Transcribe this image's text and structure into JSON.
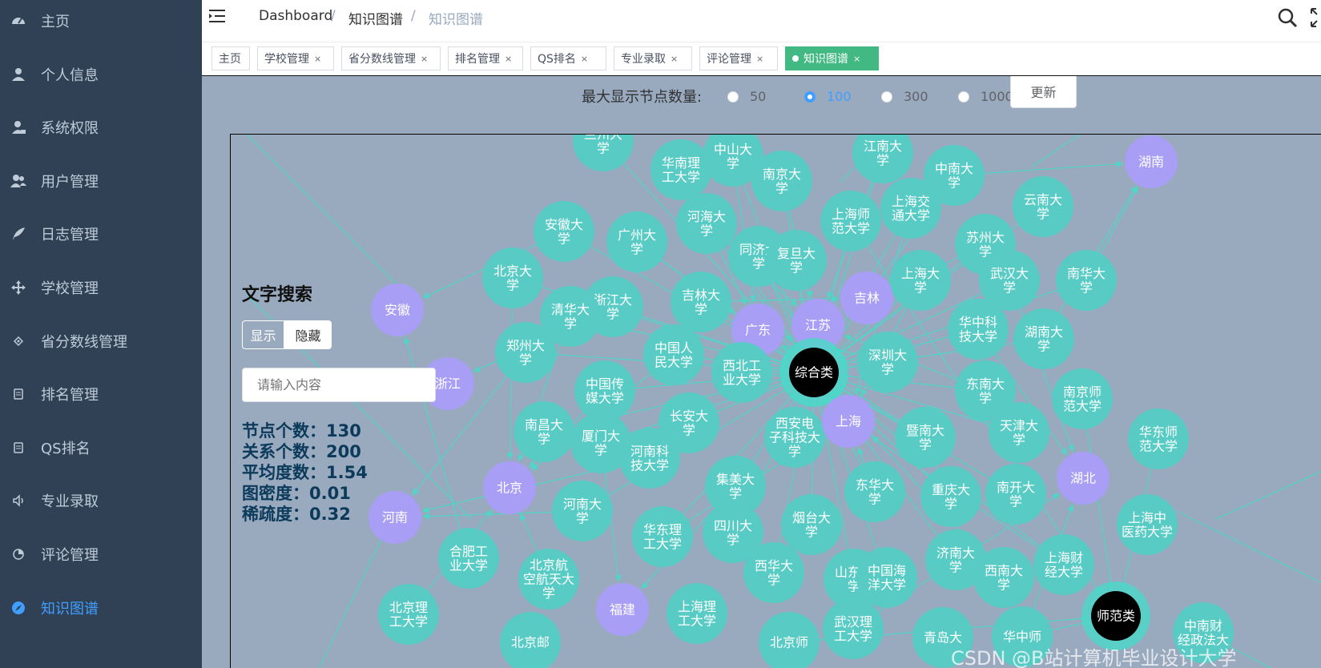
{
  "sidebar": {
    "items": [
      {
        "label": "主页",
        "icon": "dashboard-icon"
      },
      {
        "label": "个人信息",
        "icon": "user-icon"
      },
      {
        "label": "系统权限",
        "icon": "user-lock-icon"
      },
      {
        "label": "用户管理",
        "icon": "users-icon"
      },
      {
        "label": "日志管理",
        "icon": "feather-icon"
      },
      {
        "label": "学校管理",
        "icon": "move-icon"
      },
      {
        "label": "省分数线管理",
        "icon": "component-icon"
      },
      {
        "label": "排名管理",
        "icon": "table-icon"
      },
      {
        "label": "QS排名",
        "icon": "table-icon"
      },
      {
        "label": "专业录取",
        "icon": "speaker-icon"
      },
      {
        "label": "评论管理",
        "icon": "chart-icon"
      },
      {
        "label": "知识图谱",
        "icon": "compass-icon",
        "active": true
      }
    ]
  },
  "header": {
    "breadcrumb": [
      "Dashboard",
      "知识图谱",
      "知识图谱"
    ],
    "separator": "/"
  },
  "tabs": [
    {
      "label": "主页"
    },
    {
      "label": "学校管理",
      "closable": true
    },
    {
      "label": "省分数线管理",
      "closable": true
    },
    {
      "label": "排名管理",
      "closable": true
    },
    {
      "label": "QS排名",
      "closable": true
    },
    {
      "label": "专业录取",
      "closable": true
    },
    {
      "label": "评论管理",
      "closable": true
    },
    {
      "label": "知识图谱",
      "closable": true,
      "active": true
    }
  ],
  "controls": {
    "max_nodes_label": "最大显示节点数量:",
    "options": [
      "50",
      "100",
      "300",
      "1000"
    ],
    "selected": "100",
    "update_button": "更新"
  },
  "search": {
    "title": "文字搜索",
    "show_label": "显示",
    "hide_label": "隐藏",
    "placeholder": "请输入内容",
    "stats": {
      "nodes": "节点个数：130",
      "relations": "关系个数：200",
      "avg_degree": "平均度数：1.54",
      "density": "图密度：0.01",
      "sparsity": "稀疏度：0.32"
    }
  },
  "graph": {
    "colors": {
      "university": "#57cbc4",
      "province": "#a99ef6",
      "category": "#000000",
      "edge": "#4fd6c9"
    },
    "nodes": [
      {
        "id": "兰州大学",
        "type": "university"
      },
      {
        "id": "中山大学",
        "type": "university"
      },
      {
        "id": "华南理工大学",
        "type": "university"
      },
      {
        "id": "南京大学",
        "type": "university"
      },
      {
        "id": "江南大学",
        "type": "university"
      },
      {
        "id": "中南大学",
        "type": "university"
      },
      {
        "id": "湖南",
        "type": "province"
      },
      {
        "id": "云南大学",
        "type": "university"
      },
      {
        "id": "安徽大学",
        "type": "university"
      },
      {
        "id": "广州大学",
        "type": "university"
      },
      {
        "id": "河海大学",
        "type": "university"
      },
      {
        "id": "上海师范大学",
        "type": "university"
      },
      {
        "id": "上海交通大学",
        "type": "university"
      },
      {
        "id": "苏州大学",
        "type": "university"
      },
      {
        "id": "北京大学",
        "type": "university"
      },
      {
        "id": "同济大学",
        "type": "university"
      },
      {
        "id": "复旦大学",
        "type": "university"
      },
      {
        "id": "武汉大学",
        "type": "university"
      },
      {
        "id": "南华大学",
        "type": "university"
      },
      {
        "id": "安徽",
        "type": "province"
      },
      {
        "id": "浙江大学",
        "type": "university"
      },
      {
        "id": "吉林大学",
        "type": "university"
      },
      {
        "id": "吉林",
        "type": "province"
      },
      {
        "id": "上海大学",
        "type": "university"
      },
      {
        "id": "清华大学",
        "type": "university"
      },
      {
        "id": "广东",
        "type": "province"
      },
      {
        "id": "江苏",
        "type": "province"
      },
      {
        "id": "华中科技大学",
        "type": "university"
      },
      {
        "id": "湖南大学",
        "type": "university"
      },
      {
        "id": "郑州大学",
        "type": "university"
      },
      {
        "id": "中国人民大学",
        "type": "university"
      },
      {
        "id": "西北工业大学",
        "type": "university"
      },
      {
        "id": "综合类",
        "type": "category"
      },
      {
        "id": "深圳大学",
        "type": "university"
      },
      {
        "id": "浙江",
        "type": "province"
      },
      {
        "id": "中国传媒大学",
        "type": "university"
      },
      {
        "id": "东南大学",
        "type": "university"
      },
      {
        "id": "南京师范大学",
        "type": "university"
      },
      {
        "id": "南昌大学",
        "type": "university"
      },
      {
        "id": "厦门大学",
        "type": "university"
      },
      {
        "id": "长安大学",
        "type": "university"
      },
      {
        "id": "西安电子科技大学",
        "type": "university"
      },
      {
        "id": "上海",
        "type": "province"
      },
      {
        "id": "暨南大学",
        "type": "university"
      },
      {
        "id": "天津大学",
        "type": "university"
      },
      {
        "id": "华东师范大学",
        "type": "university"
      },
      {
        "id": "河南科技大学",
        "type": "university"
      },
      {
        "id": "北京",
        "type": "province"
      },
      {
        "id": "集美大学",
        "type": "university"
      },
      {
        "id": "东华大学",
        "type": "university"
      },
      {
        "id": "重庆大学",
        "type": "university"
      },
      {
        "id": "南开大学",
        "type": "university"
      },
      {
        "id": "湖北",
        "type": "province"
      },
      {
        "id": "河南",
        "type": "province"
      },
      {
        "id": "河南大学",
        "type": "university"
      },
      {
        "id": "合肥工业大学",
        "type": "university"
      },
      {
        "id": "华东理工大学",
        "type": "university"
      },
      {
        "id": "四川大学",
        "type": "university"
      },
      {
        "id": "烟台大学",
        "type": "university"
      },
      {
        "id": "上海中医药大学",
        "type": "university"
      },
      {
        "id": "北京航空航天大学",
        "type": "university"
      },
      {
        "id": "西华大学",
        "type": "university"
      },
      {
        "id": "山东大学",
        "type": "university"
      },
      {
        "id": "中国海洋大学",
        "type": "university"
      },
      {
        "id": "济南大学",
        "type": "university"
      },
      {
        "id": "西南大学",
        "type": "university"
      },
      {
        "id": "上海财经大学",
        "type": "university"
      },
      {
        "id": "北京理工大学",
        "type": "university"
      },
      {
        "id": "福建",
        "type": "province"
      },
      {
        "id": "上海理工大学",
        "type": "university"
      },
      {
        "id": "武汉理工大学",
        "type": "university"
      },
      {
        "id": "师范类",
        "type": "category"
      },
      {
        "id": "北京邮",
        "type": "university"
      },
      {
        "id": "北京师",
        "type": "university"
      },
      {
        "id": "青岛大",
        "type": "university"
      },
      {
        "id": "华中师",
        "type": "university"
      },
      {
        "id": "中南财经政法大",
        "type": "university"
      }
    ],
    "edges": [
      [
        "综合类",
        "中山大学"
      ],
      [
        "综合类",
        "南京大学"
      ],
      [
        "综合类",
        "江南大学"
      ],
      [
        "综合类",
        "中南大学"
      ],
      [
        "综合类",
        "复旦大学"
      ],
      [
        "综合类",
        "同济大学"
      ],
      [
        "综合类",
        "上海交通大学"
      ],
      [
        "综合类",
        "上海师范大学"
      ],
      [
        "综合类",
        "苏州大学"
      ],
      [
        "综合类",
        "武汉大学"
      ],
      [
        "综合类",
        "上海大学"
      ],
      [
        "综合类",
        "吉林大学"
      ],
      [
        "综合类",
        "河海大学"
      ],
      [
        "综合类",
        "浙江大学"
      ],
      [
        "综合类",
        "北京大学"
      ],
      [
        "综合类",
        "清华大学"
      ],
      [
        "综合类",
        "郑州大学"
      ],
      [
        "综合类",
        "中国人民大学"
      ],
      [
        "综合类",
        "西北工业大学"
      ],
      [
        "综合类",
        "深圳大学"
      ],
      [
        "综合类",
        "华中科技大学"
      ],
      [
        "综合类",
        "湖南大学"
      ],
      [
        "综合类",
        "东南大学"
      ],
      [
        "综合类",
        "暨南大学"
      ],
      [
        "综合类",
        "西安电子科技大学"
      ],
      [
        "综合类",
        "长安大学"
      ],
      [
        "综合类",
        "厦门大学"
      ],
      [
        "综合类",
        "南昌大学"
      ],
      [
        "综合类",
        "中国传媒大学"
      ],
      [
        "综合类",
        "天津大学"
      ],
      [
        "综合类",
        "南开大学"
      ],
      [
        "综合类",
        "重庆大学"
      ],
      [
        "综合类",
        "东华大学"
      ],
      [
        "综合类",
        "四川大学"
      ],
      [
        "综合类",
        "集美大学"
      ],
      [
        "综合类",
        "烟台大学"
      ],
      [
        "综合类",
        "西华大学"
      ],
      [
        "综合类",
        "河南大学"
      ],
      [
        "综合类",
        "华东理工大学"
      ],
      [
        "综合类",
        "广州大学"
      ],
      [
        "综合类",
        "安徽大学"
      ],
      [
        "综合类",
        "华南理工大学"
      ],
      [
        "综合类",
        "兰州大学"
      ],
      [
        "综合类",
        "云南大学"
      ],
      [
        "综合类",
        "南华大学"
      ],
      [
        "综合类",
        "济南大学"
      ],
      [
        "综合类",
        "西南大学"
      ],
      [
        "综合类",
        "上海财经大学"
      ],
      [
        "综合类",
        "中国海洋大学"
      ],
      [
        "综合类",
        "山东大学"
      ],
      [
        "江苏",
        "南京大学"
      ],
      [
        "江苏",
        "东南大学"
      ],
      [
        "江苏",
        "苏州大学"
      ],
      [
        "江苏",
        "江南大学"
      ],
      [
        "江苏",
        "河海大学"
      ],
      [
        "上海",
        "复旦大学"
      ],
      [
        "上海",
        "同济大学"
      ],
      [
        "上海",
        "上海交通大学"
      ],
      [
        "上海",
        "上海大学"
      ],
      [
        "上海",
        "东华大学"
      ],
      [
        "上海",
        "华东理工大学"
      ],
      [
        "上海",
        "上海财经大学"
      ],
      [
        "北京",
        "北京大学"
      ],
      [
        "北京",
        "清华大学"
      ],
      [
        "北京",
        "中国人民大学"
      ],
      [
        "北京",
        "中国传媒大学"
      ],
      [
        "北京",
        "北京航空航天大学"
      ],
      [
        "北京",
        "北京理工大学"
      ],
      [
        "广东",
        "中山大学"
      ],
      [
        "广东",
        "华南理工大学"
      ],
      [
        "广东",
        "广州大学"
      ],
      [
        "广东",
        "深圳大学"
      ],
      [
        "广东",
        "暨南大学"
      ],
      [
        "湖北",
        "武汉大学"
      ],
      [
        "湖北",
        "华中科技大学"
      ],
      [
        "湖北",
        "武汉理工大学"
      ],
      [
        "湖北",
        "华中师"
      ],
      [
        "湖南",
        "中南大学"
      ],
      [
        "湖南",
        "湖南大学"
      ],
      [
        "湖南",
        "南华大学"
      ],
      [
        "河南",
        "郑州大学"
      ],
      [
        "河南",
        "河南大学"
      ],
      [
        "河南",
        "河南科技大学"
      ],
      [
        "安徽",
        "安徽大学"
      ],
      [
        "安徽",
        "合肥工业大学"
      ],
      [
        "浙江",
        "浙江大学"
      ],
      [
        "吉林",
        "吉林大学"
      ],
      [
        "福建",
        "厦门大学"
      ],
      [
        "福建",
        "集美大学"
      ],
      [
        "师范类",
        "华东师范大学"
      ],
      [
        "师范类",
        "南京师范大学"
      ],
      [
        "师范类",
        "上海师范大学"
      ],
      [
        "师范类",
        "华中师"
      ],
      [
        "师范类",
        "北京师"
      ]
    ]
  },
  "watermark": "CSDN @B站计算机毕业设计大学"
}
